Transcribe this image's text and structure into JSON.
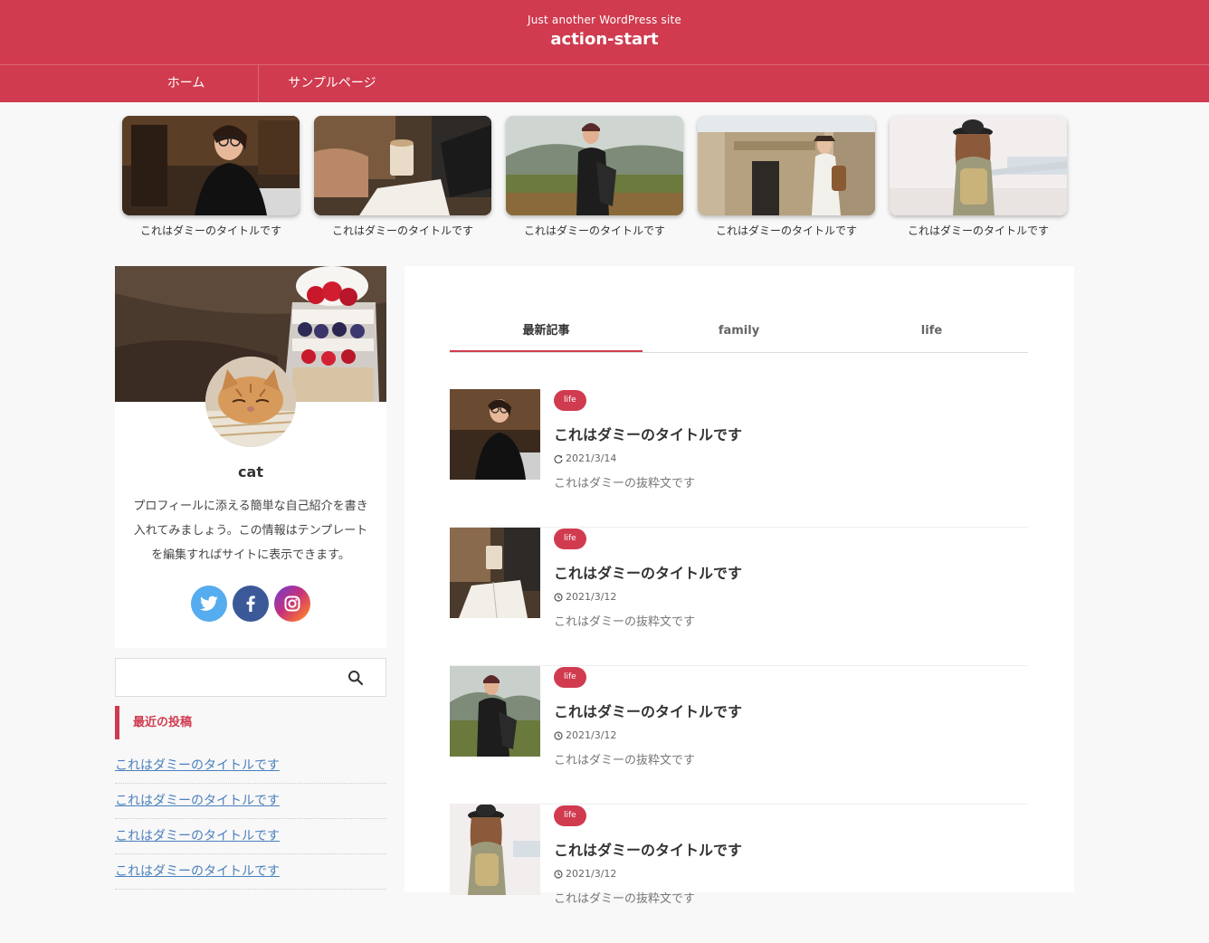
{
  "header": {
    "tagline": "Just another WordPress site",
    "site_title": "action-start",
    "brand_color": "#d03b4f"
  },
  "nav": {
    "items": [
      {
        "label": "ホーム"
      },
      {
        "label": "サンプルページ"
      }
    ]
  },
  "featured": [
    {
      "caption": "これはダミーのタイトルです"
    },
    {
      "caption": "これはダミーのタイトルです"
    },
    {
      "caption": "これはダミーのタイトルです"
    },
    {
      "caption": "これはダミーのタイトルです"
    },
    {
      "caption": "これはダミーのタイトルです"
    }
  ],
  "profile": {
    "name": "cat",
    "description": "プロフィールに添える簡単な自己紹介を書き入れてみましょう。この情報はテンプレートを編集すればサイトに表示できます。",
    "social": [
      {
        "icon": "twitter-icon"
      },
      {
        "icon": "facebook-icon"
      },
      {
        "icon": "instagram-icon"
      }
    ]
  },
  "search": {
    "placeholder": "",
    "icon": "search-icon"
  },
  "recent_posts": {
    "title": "最近の投稿",
    "items": [
      "これはダミーのタイトルです",
      "これはダミーのタイトルです",
      "これはダミーのタイトルです",
      "これはダミーのタイトルです"
    ]
  },
  "tabs": [
    {
      "label": "最新記事"
    },
    {
      "label": "family"
    },
    {
      "label": "life"
    }
  ],
  "articles": [
    {
      "category": "life",
      "title": "これはダミーのタイトルです",
      "date": "2021/3/14",
      "date_icon": "update-icon",
      "excerpt": "これはダミーの抜粋文です"
    },
    {
      "category": "life",
      "title": "これはダミーのタイトルです",
      "date": "2021/3/12",
      "date_icon": "clock-icon",
      "excerpt": "これはダミーの抜粋文です"
    },
    {
      "category": "life",
      "title": "これはダミーのタイトルです",
      "date": "2021/3/12",
      "date_icon": "clock-icon",
      "excerpt": "これはダミーの抜粋文です"
    },
    {
      "category": "life",
      "title": "これはダミーのタイトルです",
      "date": "2021/3/12",
      "date_icon": "clock-icon",
      "excerpt": "これはダミーの抜粋文です"
    }
  ]
}
